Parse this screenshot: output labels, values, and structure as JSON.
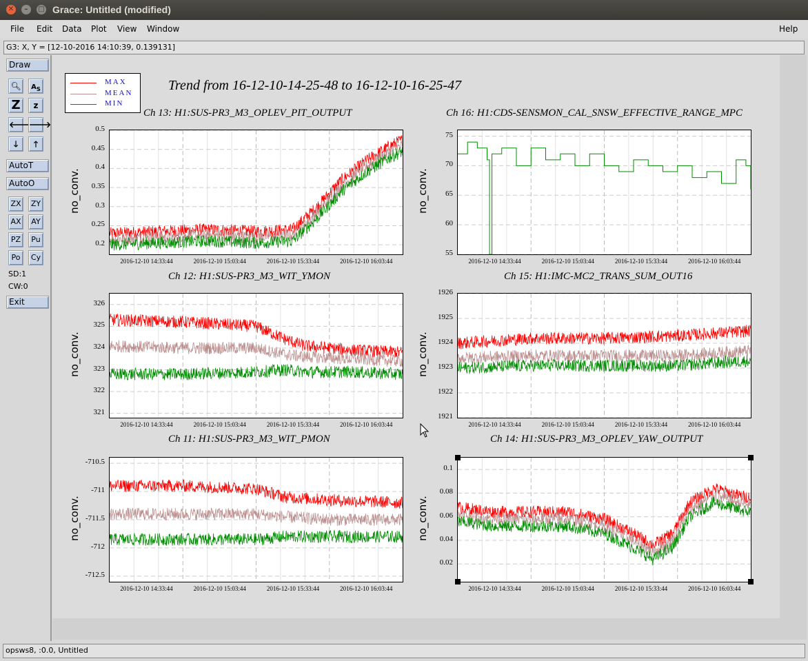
{
  "window": {
    "title": "Grace: Untitled (modified)"
  },
  "menubar": {
    "file": "File",
    "edit": "Edit",
    "data": "Data",
    "plot": "Plot",
    "view": "View",
    "window": "Window",
    "help": "Help"
  },
  "locator": "G3: X, Y = [12-10-2016 14:10:39, 0.139131]",
  "tools": {
    "draw": "Draw",
    "autot": "AutoT",
    "autoo": "AutoO",
    "exit": "Exit",
    "zx": "ZX",
    "zy": "ZY",
    "ax": "AX",
    "ay": "AY",
    "pz": "PZ",
    "pu": "Pu",
    "po": "Po",
    "cy": "Cy",
    "zoom_in": "Z",
    "zoom_out": "z",
    "sd": "SD:1",
    "cw": "CW:0"
  },
  "statusbar": "opsws8, :0.0, Untitled",
  "legend": {
    "max": "MAX",
    "mean": "MEAN",
    "min": "MIN"
  },
  "colors": {
    "max": "#ff0000",
    "mean": "#bc8f8f",
    "min": "#008c00",
    "legend_text": "#1010d0"
  },
  "main_title": "Trend from 16-12-10-14-25-48 to 16-12-10-16-25-47",
  "x_ticks": [
    "2016-12-10 14:33:44",
    "2016-12-10 15:03:44",
    "2016-12-10 15:33:44",
    "2016-12-10 16:03:44"
  ],
  "chart_data": [
    {
      "type": "line",
      "title": "Ch 13: H1:SUS-PR3_M3_OPLEV_PIT_OUTPUT",
      "ylabel": "no_conv.",
      "ylim": [
        0.175,
        0.5
      ],
      "yticks": [
        "0.5",
        "0.45",
        "0.4",
        "0.35",
        "0.3",
        "0.25",
        "0.2"
      ],
      "series": [
        {
          "name": "MAX",
          "x_minutes": [
            0,
            20,
            40,
            60,
            75,
            85,
            95,
            105,
            115,
            120
          ],
          "values": [
            0.23,
            0.235,
            0.24,
            0.235,
            0.24,
            0.3,
            0.37,
            0.42,
            0.46,
            0.475
          ]
        },
        {
          "name": "MEAN",
          "x_minutes": [
            0,
            20,
            40,
            60,
            75,
            85,
            95,
            105,
            115,
            120
          ],
          "values": [
            0.215,
            0.22,
            0.225,
            0.22,
            0.225,
            0.285,
            0.355,
            0.405,
            0.445,
            0.46
          ]
        },
        {
          "name": "MIN",
          "x_minutes": [
            0,
            20,
            40,
            60,
            75,
            85,
            95,
            105,
            115,
            120
          ],
          "values": [
            0.2,
            0.205,
            0.21,
            0.205,
            0.21,
            0.27,
            0.34,
            0.39,
            0.43,
            0.445
          ]
        }
      ]
    },
    {
      "type": "line",
      "title": "Ch 16: H1:CDS-SENSMON_CAL_SNSW_EFFECTIVE_RANGE_MPC",
      "ylabel": "no_conv.",
      "ylim": [
        55,
        76
      ],
      "yticks": [
        "75",
        "70",
        "65",
        "60",
        "55"
      ],
      "series": [
        {
          "name": "MIN",
          "x_minutes": [
            0,
            4,
            8,
            12,
            13,
            14,
            18,
            24,
            30,
            36,
            42,
            48,
            54,
            60,
            66,
            72,
            78,
            84,
            90,
            96,
            102,
            108,
            114,
            118,
            120
          ],
          "values": [
            72,
            74,
            73,
            71,
            55,
            72,
            73,
            70,
            73,
            71,
            72,
            70,
            72,
            70,
            69,
            71,
            70,
            69,
            70,
            68,
            69,
            67,
            71,
            70,
            66
          ]
        }
      ]
    },
    {
      "type": "line",
      "title": "Ch 12: H1:SUS-PR3_M3_WIT_YMON",
      "ylabel": "no_conv.",
      "ylim": [
        320.8,
        326.5
      ],
      "yticks": [
        "326",
        "325",
        "324",
        "323",
        "322",
        "321"
      ],
      "series": [
        {
          "name": "MAX",
          "x_minutes": [
            0,
            30,
            60,
            72,
            80,
            100,
            120
          ],
          "values": [
            325.3,
            325.2,
            325.0,
            324.4,
            324.1,
            323.9,
            323.8
          ]
        },
        {
          "name": "MEAN",
          "x_minutes": [
            0,
            30,
            60,
            72,
            80,
            100,
            120
          ],
          "values": [
            324.1,
            324.0,
            324.0,
            323.7,
            323.6,
            323.5,
            323.4
          ]
        },
        {
          "name": "MIN",
          "x_minutes": [
            0,
            30,
            60,
            72,
            80,
            100,
            120
          ],
          "values": [
            322.8,
            322.8,
            322.9,
            323.0,
            322.9,
            322.9,
            322.8
          ]
        }
      ]
    },
    {
      "type": "line",
      "title": "Ch 15: H1:IMC-MC2_TRANS_SUM_OUT16",
      "ylabel": "no_conv.",
      "ylim": [
        1921,
        1926
      ],
      "yticks": [
        "1926",
        "1925",
        "1924",
        "1923",
        "1922",
        "1921"
      ],
      "series": [
        {
          "name": "MAX",
          "x_minutes": [
            0,
            30,
            60,
            90,
            120
          ],
          "values": [
            1924.0,
            1924.2,
            1924.2,
            1924.3,
            1924.5
          ]
        },
        {
          "name": "MEAN",
          "x_minutes": [
            0,
            30,
            60,
            90,
            120
          ],
          "values": [
            1923.4,
            1923.5,
            1923.5,
            1923.5,
            1923.7
          ]
        },
        {
          "name": "MIN",
          "x_minutes": [
            0,
            30,
            60,
            90,
            120
          ],
          "values": [
            1923.0,
            1923.1,
            1923.1,
            1923.1,
            1923.3
          ]
        }
      ]
    },
    {
      "type": "line",
      "title": "Ch 11: H1:SUS-PR3_M3_WIT_PMON",
      "ylabel": "no_conv.",
      "ylim": [
        -712.6,
        -710.4
      ],
      "yticks": [
        "-710.5",
        "-711",
        "-711.5",
        "-712",
        "-712.5"
      ],
      "series": [
        {
          "name": "MAX",
          "x_minutes": [
            0,
            30,
            60,
            72,
            90,
            120
          ],
          "values": [
            -710.9,
            -710.9,
            -710.95,
            -711.1,
            -711.15,
            -711.2
          ]
        },
        {
          "name": "MEAN",
          "x_minutes": [
            0,
            30,
            60,
            72,
            90,
            120
          ],
          "values": [
            -711.4,
            -711.4,
            -711.4,
            -711.45,
            -711.5,
            -711.5
          ]
        },
        {
          "name": "MIN",
          "x_minutes": [
            0,
            30,
            60,
            72,
            90,
            120
          ],
          "values": [
            -711.85,
            -711.85,
            -711.85,
            -711.8,
            -711.8,
            -711.8
          ]
        }
      ]
    },
    {
      "type": "line",
      "title": "Ch 14: H1:SUS-PR3_M3_OPLEV_YAW_OUTPUT",
      "ylabel": "no_conv.",
      "ylim": [
        0.005,
        0.11
      ],
      "yticks": [
        "0.1",
        "0.08",
        "0.06",
        "0.04",
        "0.02"
      ],
      "series": [
        {
          "name": "MAX",
          "x_minutes": [
            0,
            15,
            30,
            45,
            60,
            70,
            80,
            88,
            95,
            105,
            115,
            120
          ],
          "values": [
            0.068,
            0.064,
            0.064,
            0.064,
            0.058,
            0.048,
            0.036,
            0.046,
            0.072,
            0.084,
            0.078,
            0.076
          ]
        },
        {
          "name": "MEAN",
          "x_minutes": [
            0,
            15,
            30,
            45,
            60,
            70,
            80,
            88,
            95,
            105,
            115,
            120
          ],
          "values": [
            0.062,
            0.058,
            0.058,
            0.058,
            0.052,
            0.042,
            0.03,
            0.04,
            0.066,
            0.078,
            0.072,
            0.07
          ]
        },
        {
          "name": "MIN",
          "x_minutes": [
            0,
            15,
            30,
            45,
            60,
            70,
            80,
            88,
            95,
            105,
            115,
            120
          ],
          "values": [
            0.056,
            0.052,
            0.052,
            0.052,
            0.046,
            0.036,
            0.024,
            0.034,
            0.06,
            0.072,
            0.066,
            0.064
          ]
        }
      ]
    }
  ]
}
